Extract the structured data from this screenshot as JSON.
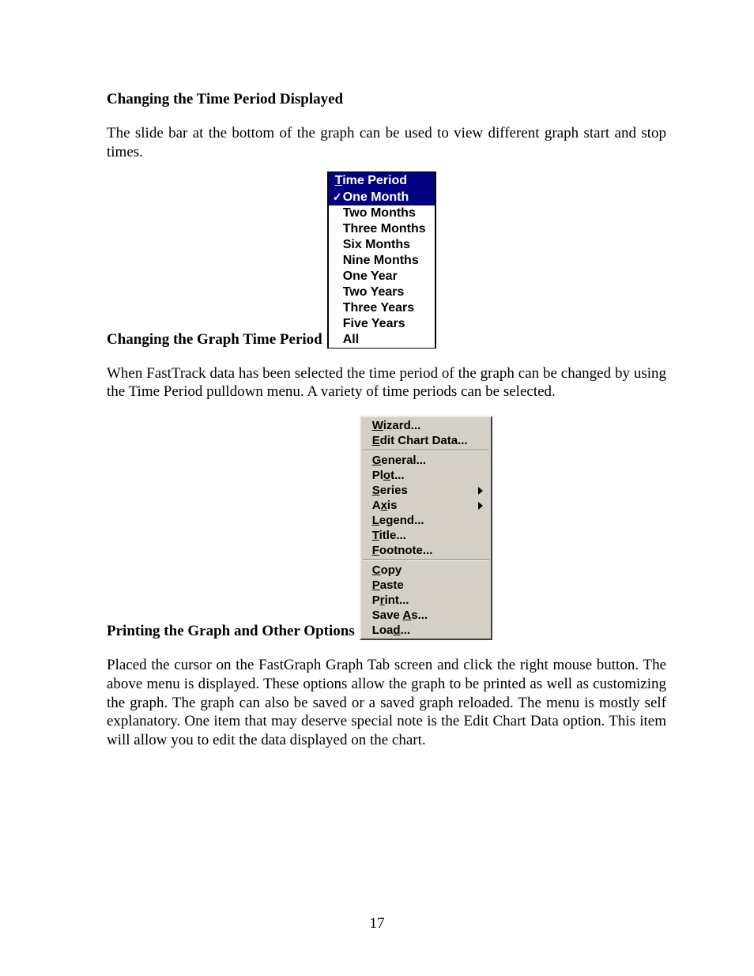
{
  "section1": {
    "heading": "Changing the Time Period Displayed",
    "para": "The slide bar at the bottom of the graph can be used to view different graph start and stop times."
  },
  "tp_menu": {
    "header_pre": "T",
    "header_rest": "ime Period",
    "items": [
      {
        "label": "One Month",
        "checked": true
      },
      {
        "label": "Two Months",
        "checked": false
      },
      {
        "label": "Three Months",
        "checked": false
      },
      {
        "label": "Six Months",
        "checked": false
      },
      {
        "label": "Nine Months",
        "checked": false
      },
      {
        "label": "One Year",
        "checked": false
      },
      {
        "label": "Two Years",
        "checked": false
      },
      {
        "label": "Three Years",
        "checked": false
      },
      {
        "label": "Five Years",
        "checked": false
      },
      {
        "label": "All",
        "checked": false
      }
    ]
  },
  "section2": {
    "heading": "Changing the Graph Time Period",
    "para": "When FastTrack data has been selected the time period of the graph can be changed by using the Time Period pulldown menu.  A variety of time periods can be selected."
  },
  "ctx_menu": {
    "groups": [
      [
        {
          "pre": "W",
          "rest": "izard...",
          "arrow": false
        },
        {
          "pre": "E",
          "rest": "dit Chart Data...",
          "arrow": false
        }
      ],
      [
        {
          "pre": "G",
          "rest": "eneral...",
          "arrow": false
        },
        {
          "before": "Pl",
          "pre": "o",
          "rest": "t...",
          "arrow": false
        },
        {
          "pre": "S",
          "rest": "eries",
          "arrow": true
        },
        {
          "before": "A",
          "pre": "x",
          "rest": "is",
          "arrow": true
        },
        {
          "pre": "L",
          "rest": "egend...",
          "arrow": false
        },
        {
          "pre": "T",
          "rest": "itle...",
          "arrow": false
        },
        {
          "pre": "F",
          "rest": "ootnote...",
          "arrow": false
        }
      ],
      [
        {
          "pre": "C",
          "rest": "opy",
          "arrow": false
        },
        {
          "pre": "P",
          "rest": "aste",
          "arrow": false
        },
        {
          "before": "P",
          "pre": "r",
          "rest": "int...",
          "arrow": false
        },
        {
          "before": "Save ",
          "pre": "A",
          "rest": "s...",
          "arrow": false
        },
        {
          "before": "Loa",
          "pre": "d",
          "rest": "...",
          "arrow": false
        }
      ]
    ]
  },
  "section3": {
    "heading": "Printing the Graph and Other Options",
    "para": "Placed the cursor on the FastGraph Graph Tab screen and click the right mouse button.  The above menu is displayed.  These options allow the graph to be printed as well as customizing the graph.  The graph can also be saved or a saved graph reloaded.  The menu is mostly self explanatory.  One item that may deserve special note is the Edit Chart Data option.  This item will allow you to edit the data displayed on the chart."
  },
  "page_number": "17",
  "check_glyph": "✓"
}
